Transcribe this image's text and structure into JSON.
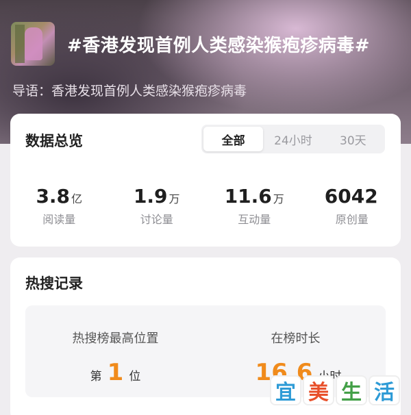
{
  "header": {
    "title": "#香港发现首例人类感染猴疱疹病毒#",
    "guide_label": "导语：",
    "guide_text": "香港发现首例人类感染猴疱疹病毒"
  },
  "overview": {
    "title": "数据总览",
    "tabs": [
      "全部",
      "24小时",
      "30天"
    ],
    "active_tab": "全部",
    "stats": [
      {
        "value": "3.8",
        "unit": "亿",
        "label": "阅读量"
      },
      {
        "value": "1.9",
        "unit": "万",
        "label": "讨论量"
      },
      {
        "value": "11.6",
        "unit": "万",
        "label": "互动量"
      },
      {
        "value": "6042",
        "unit": "",
        "label": "原创量"
      }
    ]
  },
  "hot_search": {
    "title": "热搜记录",
    "highest_label": "热搜榜最高位置",
    "position_prefix": "第",
    "position_value": "1",
    "position_suffix": "位",
    "duration_label": "在榜时长",
    "duration_value": "16.6",
    "duration_unit": "小时"
  },
  "watermark": {
    "chars": [
      "宜",
      "美",
      "生",
      "活"
    ],
    "colors": [
      "#2e9bd6",
      "#e8502a",
      "#43a047",
      "#2e9bd6"
    ]
  }
}
